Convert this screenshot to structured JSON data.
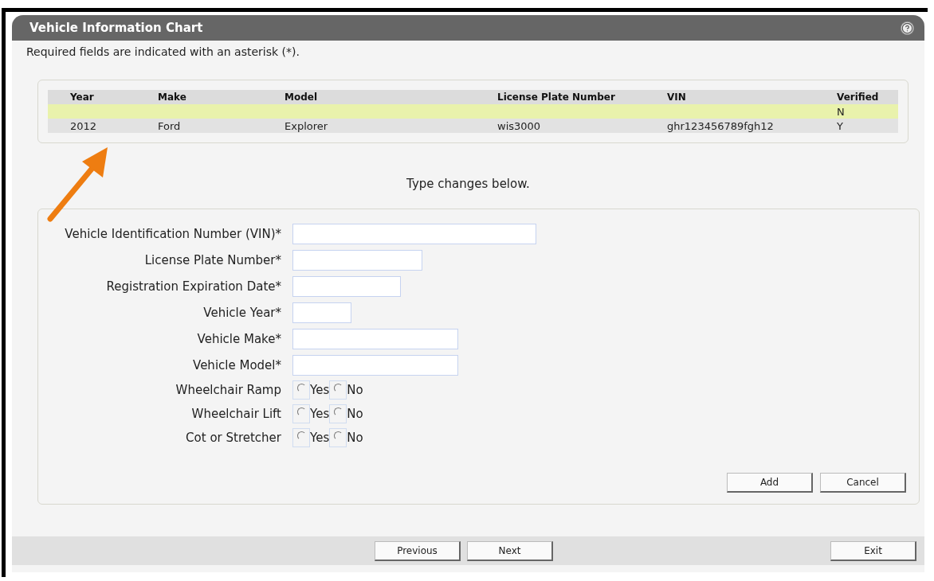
{
  "window": {
    "title": "Vehicle Information Chart"
  },
  "intro": "Required fields are indicated with an asterisk (*).",
  "table": {
    "columns": [
      "Year",
      "Make",
      "Model",
      "License Plate Number",
      "VIN",
      "Verified"
    ],
    "rows": [
      {
        "selected": true,
        "cells": [
          "",
          "",
          "",
          "",
          "",
          "N"
        ]
      },
      {
        "selected": false,
        "cells": [
          "2012",
          "Ford",
          "Explorer",
          "wis3000",
          "ghr123456789fgh12",
          "Y"
        ]
      }
    ]
  },
  "instruction": "Type changes below.",
  "fields": [
    {
      "kind": "text",
      "label": "Vehicle Identification Number (VIN)*"
    },
    {
      "kind": "text",
      "label": "License Plate Number*"
    },
    {
      "kind": "text",
      "label": "Registration Expiration Date*"
    },
    {
      "kind": "text",
      "label": "Vehicle Year*"
    },
    {
      "kind": "text",
      "label": "Vehicle Make*"
    },
    {
      "kind": "text",
      "label": "Vehicle Model*"
    },
    {
      "kind": "radio",
      "label": "Wheelchair Ramp",
      "options": [
        {
          "label": "Yes",
          "selected": false
        },
        {
          "label": "No",
          "selected": false
        }
      ]
    },
    {
      "kind": "radio",
      "label": "Wheelchair Lift",
      "options": [
        {
          "label": "Yes",
          "selected": false
        },
        {
          "label": "No",
          "selected": false
        }
      ]
    },
    {
      "kind": "radio",
      "label": "Cot or Stretcher",
      "options": [
        {
          "label": "Yes",
          "selected": false
        },
        {
          "label": "No",
          "selected": false
        }
      ]
    }
  ],
  "form_buttons": [
    "Add",
    "Cancel"
  ],
  "footer": {
    "nav_buttons": [
      "Previous",
      "Next"
    ],
    "exit_button": "Exit"
  }
}
